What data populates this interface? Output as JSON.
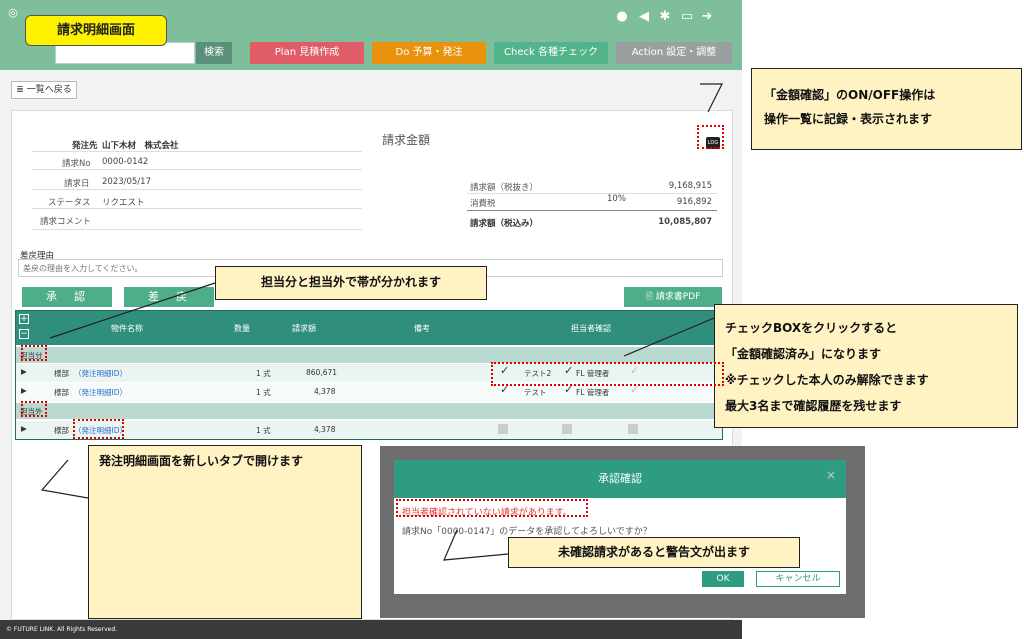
{
  "header": {
    "title": "請求明細画面",
    "search_button": "検索",
    "nav": [
      {
        "label": "Plan 見積作成",
        "color": "#e05c66"
      },
      {
        "label": "Do 予算・発注",
        "color": "#e8920e"
      },
      {
        "label": "Check 各種チェック",
        "color": "#53b38b"
      },
      {
        "label": "Action 設定・調整",
        "color": "#9aa0a0"
      }
    ]
  },
  "back_button": "≣ 一覧へ戻る",
  "invoice": {
    "vendor_label": "発注先",
    "vendor": "山下木材　株式会社",
    "no_label": "請求No",
    "no": "0000-0142",
    "date_label": "請求日",
    "date": "2023/05/17",
    "status_label": "ステータス",
    "status": "リクエスト",
    "comment_label": "請求コメント",
    "amount_title": "請求金額",
    "log_label": "LOG",
    "subtotal_label": "請求額（税抜き）",
    "subtotal": "9,168,915",
    "tax_label": "消費税",
    "tax_rate": "10%",
    "tax": "916,892",
    "total_label": "請求額（税込み）",
    "total": "10,085,807"
  },
  "reject": {
    "label": "差戻理由",
    "placeholder": "差戻の理由を入力してください。"
  },
  "actions": {
    "approve": "承　認",
    "reject": "差　戻",
    "pdf": "🖹 請求書PDF"
  },
  "table": {
    "columns": [
      "物件名称",
      "数量",
      "請求額",
      "備考",
      "担当者確認"
    ],
    "band_own": "担当分",
    "band_other": "担当外",
    "rows": [
      {
        "name": "様部",
        "link": "（発注明細ID）",
        "qty": "1 式",
        "amount": "860,671",
        "check1": "テスト2",
        "check2": "FL 管理者"
      },
      {
        "name": "様部",
        "link": "（発注明細ID）",
        "qty": "1 式",
        "amount": "4,378",
        "check1": "テスト",
        "check2": "FL 管理者"
      },
      {
        "name": "様部",
        "link": "（発注明細ID）",
        "qty": "1 式",
        "amount": "4,378",
        "check1": "",
        "check2": ""
      }
    ]
  },
  "footer": "© FUTURE LINK. All Rights Reserved.",
  "modal": {
    "title": "承認確認",
    "warning": "担当者確認されていない請求があります。",
    "message": "請求No「0000-0147」のデータを承認してよろしいですか？",
    "ok": "OK",
    "cancel": "キャンセル"
  },
  "callouts": {
    "log": "「金額確認」のON/OFF操作は\n操作一覧に記録・表示されます",
    "band": "担当分と担当外で帯が分かれます",
    "check": "チェックBOXをクリックすると\n「金額確認済み」になります\n※チェックした本人のみ解除できます\n最大3名まで確認履歴を残せます",
    "newtab": "発注明細画面を新しいタブで開けます",
    "warning": "未確認請求があると警告文が出ます"
  }
}
